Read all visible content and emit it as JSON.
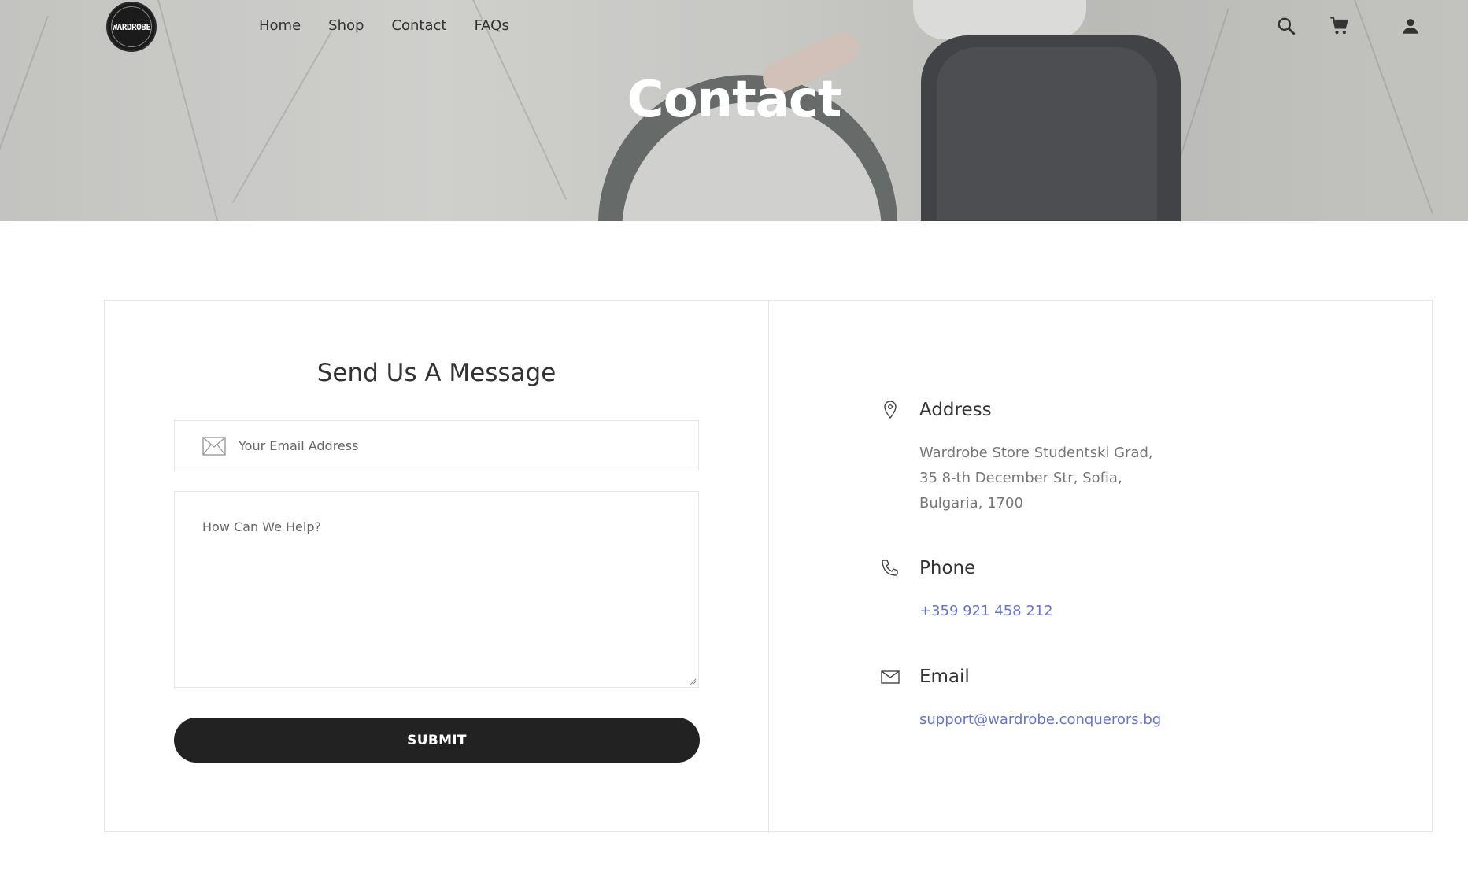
{
  "header": {
    "logo_text": "WARDROBE",
    "nav": [
      "Home",
      "Shop",
      "Contact",
      "FAQs"
    ],
    "icons": [
      "search-icon",
      "cart-icon",
      "user-icon"
    ]
  },
  "hero": {
    "title": "Contact"
  },
  "form": {
    "title": "Send Us A Message",
    "email_placeholder": "Your Email Address",
    "message_placeholder": "How Can We Help?",
    "submit_label": "SUBMIT"
  },
  "info": {
    "address_label": "Address",
    "address_lines": [
      "Wardrobe Store Studentski Grad,",
      "35 8-th December Str, Sofia,",
      "Bulgaria, 1700"
    ],
    "phone_label": "Phone",
    "phone": "+359 921 458 212",
    "email_label": "Email",
    "email": "support@wardrobe.conquerors.bg"
  },
  "colors": {
    "link": "#6674cc",
    "button": "#222222",
    "border": "#e6e6e6"
  }
}
